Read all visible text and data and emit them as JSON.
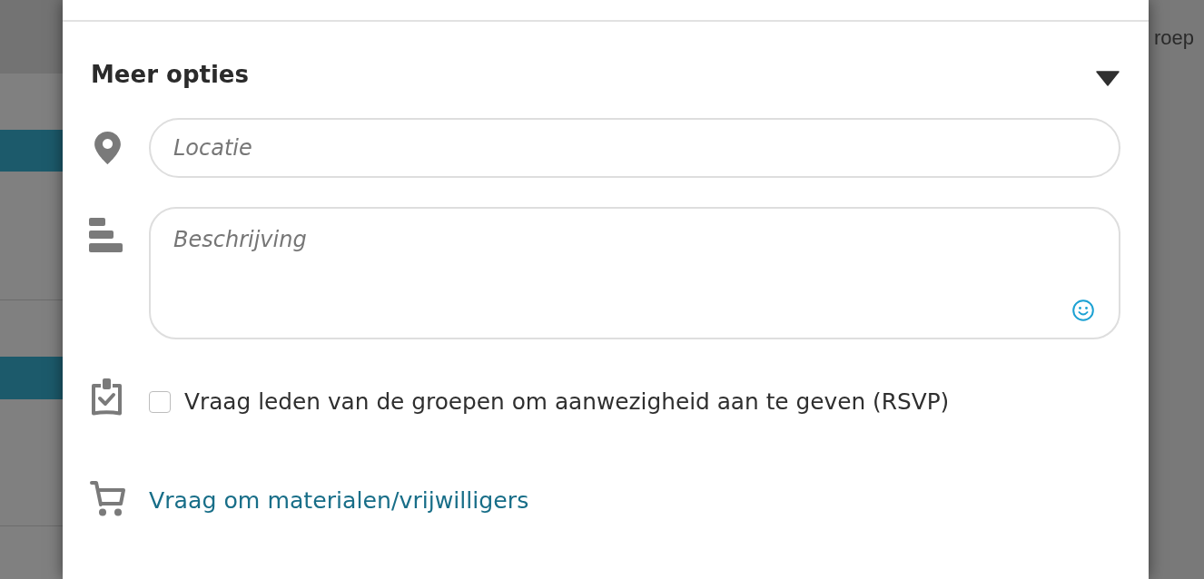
{
  "backdrop": {
    "side_text": "roep"
  },
  "more_options": {
    "title": "Meer opties",
    "expanded": true
  },
  "fields": [
    {
      "kind": "input",
      "placeholder": "Locatie"
    },
    {
      "kind": "textarea",
      "placeholder": "Beschrijving"
    }
  ],
  "rsvp": {
    "label": "Vraag leden van de groepen om aanwezigheid aan te geven (RSVP)",
    "checked": false
  },
  "materials_link": {
    "label": "Vraag om materialen/vrijwilligers"
  }
}
